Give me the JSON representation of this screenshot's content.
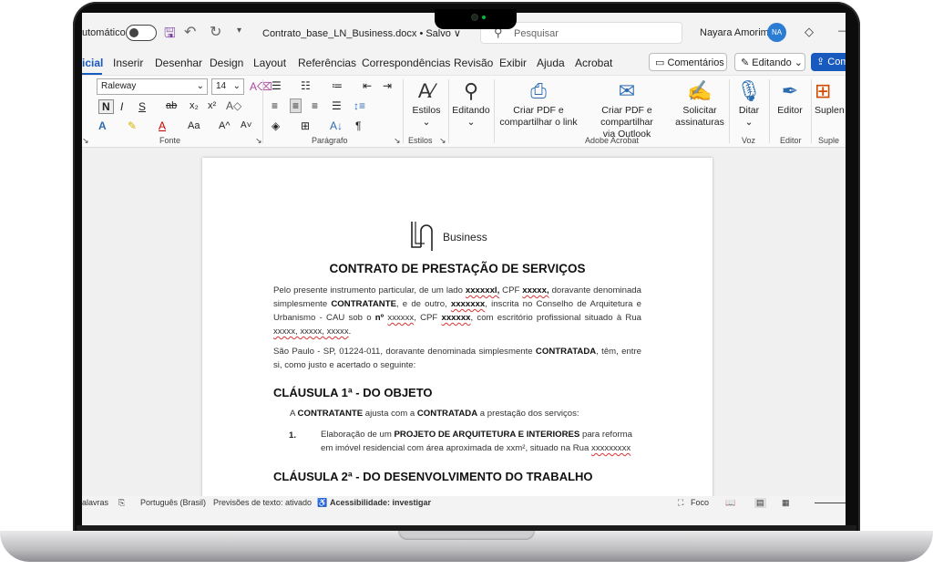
{
  "titlebar": {
    "autosave_label": "utomático",
    "doc_title": "Contrato_base_LN_Business.docx • Salvo ∨",
    "search_placeholder": "Pesquisar",
    "user_name": "Nayara Amorim",
    "user_initials": "NA",
    "minimize": "—"
  },
  "tabs": {
    "items": [
      "icial",
      "Inserir",
      "Desenhar",
      "Design",
      "Layout",
      "Referências",
      "Correspondências",
      "Revisão",
      "Exibir",
      "Ajuda",
      "Acrobat"
    ],
    "comments_label": "Comentários",
    "editing_label": "Editando ⌄",
    "share_label": "Com"
  },
  "ribbon": {
    "font_name": "Raleway",
    "font_size": "14",
    "bold": "N",
    "italic": "I",
    "underline": "S",
    "strike": "ab",
    "subscript": "x₂",
    "superscript": "x²",
    "case": "Aa",
    "grow": "A^",
    "shrink": "A˅",
    "pilcrow": "¶",
    "styles_label": "Estilos",
    "editing_label": "Editando",
    "pdf_link_label_1": "Criar PDF e",
    "pdf_link_label_2": "compartilhar o link",
    "pdf_outlook_label_1": "Criar PDF e compartilhar",
    "pdf_outlook_label_2": "via Outlook",
    "sign_label_1": "Solicitar",
    "sign_label_2": "assinaturas",
    "dictate_label": "Ditar",
    "editor_label": "Editor",
    "addins_label": "Suplen",
    "groups": {
      "font": "Fonte",
      "paragraph": "Parágrafo",
      "styles": "Estilos",
      "acrobat": "Adobe Acrobat",
      "voice": "Voz",
      "editor": "Editor",
      "addins": "Suple"
    }
  },
  "document": {
    "logo_text": "Business",
    "title": "CONTRATO DE PRESTAÇÃO DE SERVIÇOS",
    "p1": {
      "a": "Pelo presente instrumento particular, de um lado ",
      "b": "xxxxxxl,",
      "c": " CPF ",
      "d": "xxxxx,",
      "e": " doravante denominada simplesmente ",
      "f": "CONTRATANTE",
      "g": ", e de outro, ",
      "h": "xxxxxxx",
      "i": ", inscrita no Conselho de Arquitetura e Urbanismo - CAU sob o ",
      "j": "nº",
      "k": " ",
      "l": "xxxxxx",
      "m": ", CPF ",
      "n": "xxxxxx",
      "o": ", com escritório profissional situado à Rua ",
      "p": "xxxxx, xxxxx, xxxxx",
      "q": "."
    },
    "p2": {
      "a": "São Paulo - SP, 01224-011, doravante denominada simplesmente ",
      "b": "CONTRATADA",
      "c": ", têm, entre si, como justo e acertado o seguinte:"
    },
    "clause1_title": "CLÁUSULA 1ª - DO OBJETO",
    "clause1_intro": {
      "a": "A ",
      "b": "CONTRATANTE",
      "c": " ajusta com a ",
      "d": "CONTRATADA",
      "e": " a prestação dos serviços:"
    },
    "item1_num": "1.",
    "item1": {
      "a": "Elaboração de um ",
      "b": "PROJETO DE ARQUITETURA E INTERIORES",
      "c": " para reforma em imóvel residencial com área aproximada de xxm², situado na Rua ",
      "d": "xxxxxxxxx"
    },
    "clause2_title": "CLÁUSULA 2ª - DO DESENVOLVIMENTO DO TRABALHO"
  },
  "statusbar": {
    "words": "alavras",
    "language": "Português (Brasil)",
    "predictions": "Previsões de texto: ativado",
    "accessibility": "Acessibilidade: investigar",
    "focus": "Foco"
  }
}
